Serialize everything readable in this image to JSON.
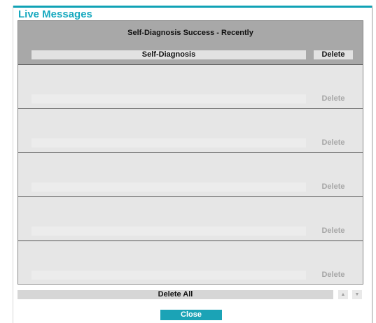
{
  "dialog": {
    "title": "Live Messages",
    "accent_color": "#17a9bf"
  },
  "panel": {
    "header_title": "Self-Diagnosis Success - Recently",
    "column_label": "Self-Diagnosis",
    "delete_label": "Delete"
  },
  "slots": [
    {
      "message": "",
      "delete_label": "Delete"
    },
    {
      "message": "",
      "delete_label": "Delete"
    },
    {
      "message": "",
      "delete_label": "Delete"
    },
    {
      "message": "",
      "delete_label": "Delete"
    },
    {
      "message": "",
      "delete_label": "Delete"
    }
  ],
  "footer": {
    "delete_all_label": "Delete All",
    "scroll_up_icon": "chevron-up-icon",
    "scroll_down_icon": "chevron-down-icon",
    "close_label": "Close"
  }
}
